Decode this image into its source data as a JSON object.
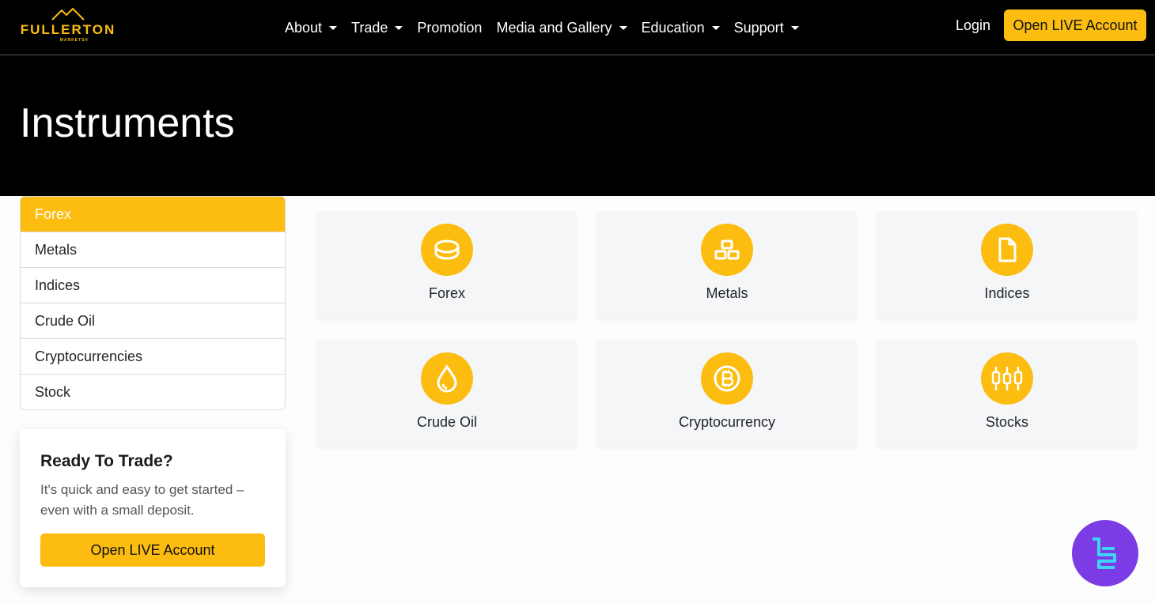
{
  "header": {
    "logo_text": "FULLERTON",
    "logo_subtext": "MARKETS®",
    "nav": [
      {
        "label": "About",
        "dropdown": true
      },
      {
        "label": "Trade",
        "dropdown": true
      },
      {
        "label": "Promotion",
        "dropdown": false
      },
      {
        "label": "Media and Gallery",
        "dropdown": true
      },
      {
        "label": "Education",
        "dropdown": true
      },
      {
        "label": "Support",
        "dropdown": true
      }
    ],
    "login_label": "Login",
    "cta_label": "Open LIVE Account"
  },
  "hero": {
    "title": "Instruments"
  },
  "sidebar": {
    "items": [
      {
        "label": "Forex",
        "active": true
      },
      {
        "label": "Metals",
        "active": false
      },
      {
        "label": "Indices",
        "active": false
      },
      {
        "label": "Crude Oil",
        "active": false
      },
      {
        "label": "Cryptocurrencies",
        "active": false
      },
      {
        "label": "Stock",
        "active": false
      }
    ]
  },
  "trade_card": {
    "title": "Ready To Trade?",
    "text": "It's quick and easy to get started – even with a small deposit.",
    "button_label": "Open LIVE Account"
  },
  "instruments": [
    {
      "label": "Forex",
      "icon": "coins-icon"
    },
    {
      "label": "Metals",
      "icon": "gold-bars-icon"
    },
    {
      "label": "Indices",
      "icon": "document-icon"
    },
    {
      "label": "Crude Oil",
      "icon": "oil-drop-icon"
    },
    {
      "label": "Cryptocurrency",
      "icon": "bitcoin-icon"
    },
    {
      "label": "Stocks",
      "icon": "candlestick-icon"
    }
  ],
  "colors": {
    "accent": "#fcbd10",
    "header_bg": "#000000",
    "card_bg": "#f5f6f7",
    "badge_bg": "#7b3ce6",
    "badge_logo": "#3fd3f5"
  }
}
